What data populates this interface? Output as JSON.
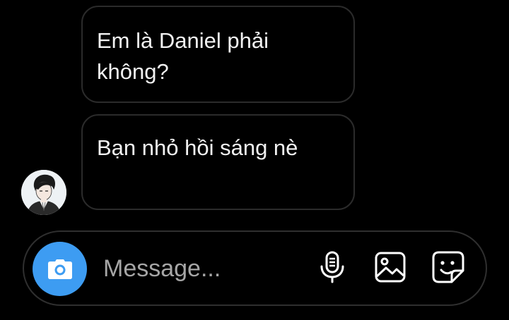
{
  "thread": {
    "messages": [
      {
        "text": "Em là Daniel phải không?"
      },
      {
        "text": "Bạn nhỏ hồi sáng nè"
      }
    ]
  },
  "composer": {
    "placeholder": "Message...",
    "icons": {
      "camera": "camera-icon",
      "voice": "microphone-icon",
      "gallery": "image-icon",
      "sticker": "sticker-icon"
    }
  },
  "colors": {
    "background": "#000000",
    "bubble_border": "#2b2b2b",
    "accent": "#3d9cf2",
    "placeholder": "#a6a6a6"
  }
}
